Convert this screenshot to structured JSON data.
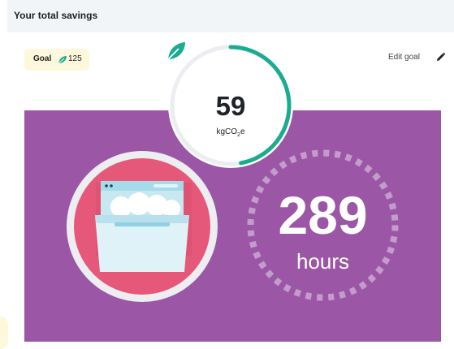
{
  "header": {
    "title": "Your total savings"
  },
  "goal": {
    "label": "Goal",
    "value": "125",
    "icon": "leaf-icon"
  },
  "edit_goal": {
    "label": "Edit goal",
    "icon": "pencil-icon"
  },
  "gauge": {
    "value": "59",
    "unit_main": "kgCO",
    "unit_sub": "2",
    "unit_tail": "e",
    "progress_fraction": 0.472,
    "color": "#1bab93",
    "icon": "leaf-icon"
  },
  "equivalence": {
    "value": "289",
    "unit": "hours",
    "illustration": "dishwasher-icon",
    "background_color": "#9b57a6"
  }
}
